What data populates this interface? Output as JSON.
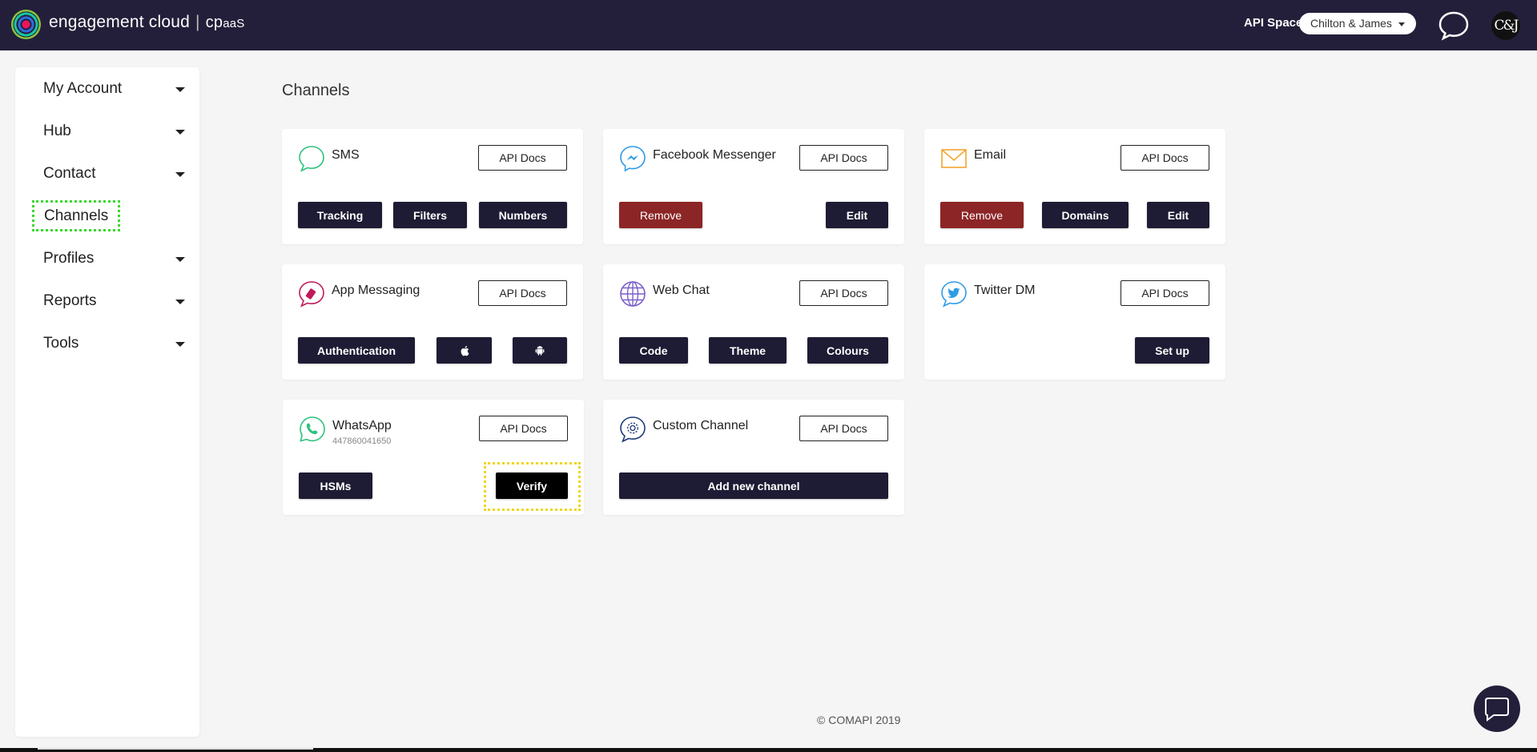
{
  "header": {
    "brand_name": "engagement cloud",
    "brand_suffix_cp": "cp",
    "brand_suffix_aas": "aaS",
    "api_space_label": "API Space:",
    "api_space_value": "Chilton & James",
    "avatar_initials": "C&J"
  },
  "sidebar": {
    "items": [
      {
        "label": "My Account"
      },
      {
        "label": "Hub"
      },
      {
        "label": "Contact"
      },
      {
        "label": "Channels"
      },
      {
        "label": "Profiles"
      },
      {
        "label": "Reports"
      },
      {
        "label": "Tools"
      }
    ]
  },
  "main": {
    "title": "Channels",
    "api_docs_label": "API Docs",
    "cards": {
      "sms": {
        "name": "SMS",
        "buttons": [
          "Tracking",
          "Filters",
          "Numbers"
        ]
      },
      "facebook": {
        "name": "Facebook Messenger",
        "buttons": [
          "Remove",
          "Edit"
        ]
      },
      "email": {
        "name": "Email",
        "buttons": [
          "Remove",
          "Domains",
          "Edit"
        ]
      },
      "app": {
        "name": "App Messaging",
        "buttons": [
          "Authentication"
        ]
      },
      "webchat": {
        "name": "Web Chat",
        "buttons": [
          "Code",
          "Theme",
          "Colours"
        ]
      },
      "twitter": {
        "name": "Twitter DM",
        "buttons": [
          "Set up"
        ]
      },
      "whatsapp": {
        "name": "WhatsApp",
        "number": "447860041650",
        "buttons": [
          "HSMs",
          "Verify"
        ]
      },
      "custom": {
        "name": "Custom Channel",
        "buttons": [
          "Add new channel"
        ]
      }
    }
  },
  "footer": {
    "copyright": "© COMAPI 2019"
  },
  "colors": {
    "topbar": "#231f3a",
    "button": "#1e1b34",
    "danger": "#8c2526",
    "active_outline": "#3ad82e",
    "verify_outline": "#f0d61a"
  }
}
